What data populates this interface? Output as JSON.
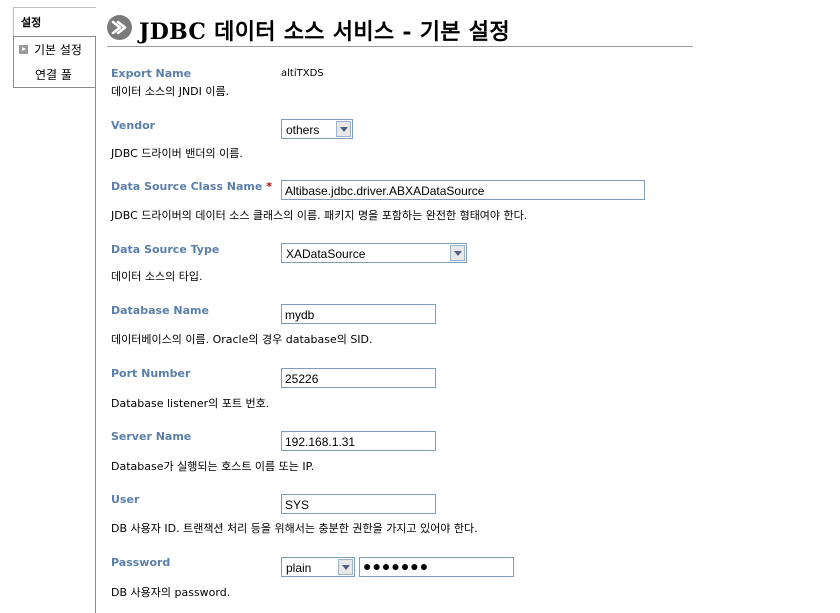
{
  "nav": {
    "tab_label": "설정",
    "items": [
      {
        "label": "기본 설정",
        "active": true
      },
      {
        "label": "연결 풀",
        "active": false
      }
    ]
  },
  "header": {
    "title": "JDBC 데이터 소스 서비스 - 기본 설정"
  },
  "form": {
    "export_name": {
      "label": "Export Name",
      "value": "altiTXDS",
      "desc": "데이터 소스의 JNDI 이름."
    },
    "vendor": {
      "label": "Vendor",
      "value": "others",
      "desc": "JDBC 드라이버 밴더의 이름."
    },
    "ds_class": {
      "label": "Data Source Class Name",
      "required_mark": "*",
      "value": "Altibase.jdbc.driver.ABXADataSource",
      "desc": "JDBC 드라이버의 데이터 소스 클래스의 이름. 패키지 명을 포함하는 완전한 형태여야 한다."
    },
    "ds_type": {
      "label": "Data Source Type",
      "value": "XADataSource",
      "desc": "데이터 소스의 타입."
    },
    "db_name": {
      "label": "Database Name",
      "value": "mydb",
      "desc": "데이터베이스의 이름. Oracle의 경우 database의 SID."
    },
    "port": {
      "label": "Port Number",
      "value": "25226",
      "desc": "Database listener의 포트 번호."
    },
    "server": {
      "label": "Server Name",
      "value": "192.168.1.31",
      "desc": "Database가 실행되는 호스트 이름 또는 IP."
    },
    "user": {
      "label": "User",
      "value": "SYS",
      "desc": "DB 사용자 ID. 트랜잭션 처리 등을 위해서는 충분한 권한을 가지고 있어야 한다."
    },
    "password": {
      "label": "Password",
      "mode": "plain",
      "value": "●●●●●●●",
      "desc": "DB 사용자의 password."
    }
  },
  "colors": {
    "label": "#5b7fa8",
    "required": "#cc0000",
    "input_border": "#7f9db9"
  }
}
